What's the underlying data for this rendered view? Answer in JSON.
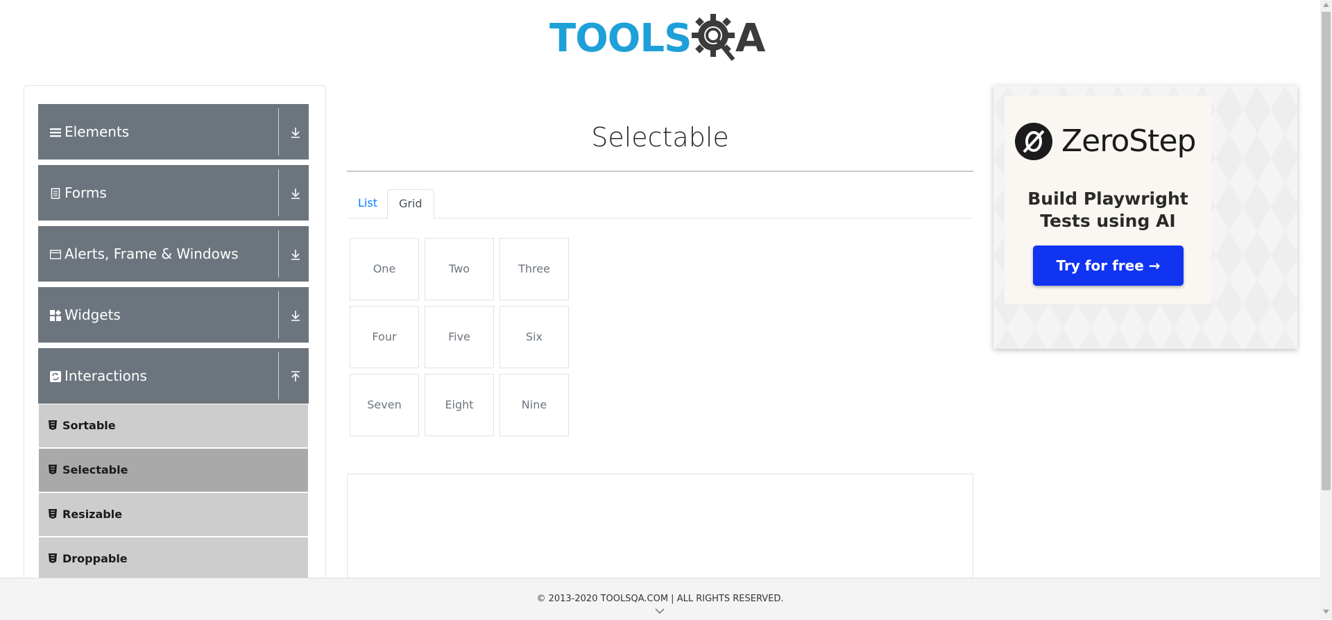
{
  "header": {
    "logo_part1": "TOOLS",
    "logo_part2": "A"
  },
  "sidebar": {
    "groups": [
      {
        "label": "Elements",
        "icon": "menu-icon"
      },
      {
        "label": "Forms",
        "icon": "document-icon"
      },
      {
        "label": "Alerts, Frame & Windows",
        "icon": "window-icon"
      },
      {
        "label": "Widgets",
        "icon": "widgets-icon"
      },
      {
        "label": "Interactions",
        "icon": "refresh-icon",
        "expanded": true
      }
    ],
    "items": [
      {
        "label": "Sortable"
      },
      {
        "label": "Selectable",
        "active": true
      },
      {
        "label": "Resizable"
      },
      {
        "label": "Droppable"
      }
    ]
  },
  "main": {
    "title": "Selectable",
    "tabs": [
      {
        "label": "List"
      },
      {
        "label": "Grid",
        "active": true
      }
    ],
    "grid": [
      "One",
      "Two",
      "Three",
      "Four",
      "Five",
      "Six",
      "Seven",
      "Eight",
      "Nine"
    ]
  },
  "ad": {
    "brand": "ZeroStep",
    "tagline_line1": "Build Playwright",
    "tagline_line2": "Tests using AI",
    "button": "Try for free →",
    "button_color": "#1034f2"
  },
  "footer": {
    "text": "© 2013-2020 TOOLSQA.COM | ALL RIGHTS RESERVED."
  },
  "colors": {
    "brand_blue": "#1ea0d8",
    "menu_header": "#6c757d",
    "submenu": "#cdcdcd",
    "submenu_active": "#a9a9a9",
    "link": "#007bff"
  }
}
